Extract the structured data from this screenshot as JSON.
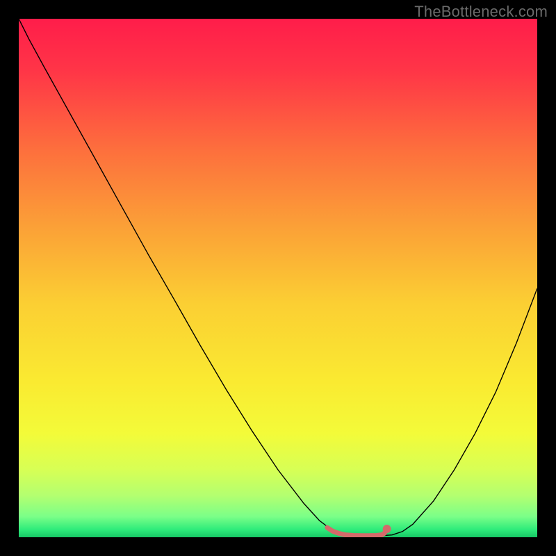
{
  "watermark": {
    "text": "TheBottleneck.com"
  },
  "chart_data": {
    "type": "line",
    "title": "",
    "xlabel": "",
    "ylabel": "",
    "xlim": [
      0,
      100
    ],
    "ylim": [
      0,
      100
    ],
    "grid": false,
    "legend": false,
    "background_gradient": {
      "stops": [
        {
          "offset": 0.0,
          "color": "#ff1d4a"
        },
        {
          "offset": 0.1,
          "color": "#ff3547"
        },
        {
          "offset": 0.25,
          "color": "#fd6e3d"
        },
        {
          "offset": 0.4,
          "color": "#fba037"
        },
        {
          "offset": 0.55,
          "color": "#fbcf33"
        },
        {
          "offset": 0.7,
          "color": "#faea31"
        },
        {
          "offset": 0.8,
          "color": "#f3fb39"
        },
        {
          "offset": 0.87,
          "color": "#d7ff55"
        },
        {
          "offset": 0.92,
          "color": "#b3ff70"
        },
        {
          "offset": 0.96,
          "color": "#7bff88"
        },
        {
          "offset": 0.985,
          "color": "#2fec7b"
        },
        {
          "offset": 1.0,
          "color": "#17c765"
        }
      ]
    },
    "series": [
      {
        "name": "bottleneck-curve",
        "type": "line",
        "color": "#000000",
        "width": 1.4,
        "x": [
          0.0,
          2.0,
          5.0,
          10.0,
          15.0,
          20.0,
          25.0,
          30.0,
          35.0,
          40.0,
          45.0,
          50.0,
          55.0,
          58.0,
          60.0,
          62.0,
          66.0,
          70.0,
          72.0,
          74.0,
          76.0,
          80.0,
          84.0,
          88.0,
          92.0,
          96.0,
          100.0
        ],
        "y": [
          100.0,
          96.0,
          90.5,
          81.5,
          72.5,
          63.5,
          54.5,
          45.8,
          37.0,
          28.5,
          20.5,
          13.0,
          6.5,
          3.2,
          1.7,
          0.9,
          0.35,
          0.3,
          0.45,
          1.1,
          2.5,
          7.0,
          13.0,
          20.0,
          28.0,
          37.5,
          48.0
        ]
      },
      {
        "name": "optimal-range-marker",
        "type": "line",
        "color": "#d46a6a",
        "width": 7.0,
        "linecap": "round",
        "x": [
          59.5,
          60.5,
          61.7,
          63.0,
          64.5,
          66.0,
          67.5,
          69.0,
          70.0,
          70.5,
          70.8
        ],
        "y": [
          1.85,
          1.2,
          0.75,
          0.45,
          0.33,
          0.3,
          0.3,
          0.34,
          0.45,
          0.75,
          1.25
        ]
      },
      {
        "name": "optimal-end-dot",
        "type": "scatter",
        "color": "#d46a6a",
        "radius": 6.0,
        "x": [
          71.0
        ],
        "y": [
          1.6
        ]
      }
    ]
  }
}
